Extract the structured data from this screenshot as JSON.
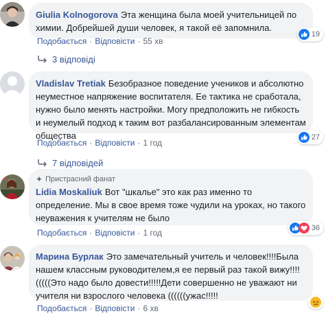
{
  "comments": [
    {
      "author": "Giulia Kolnogorova",
      "text": "Эта женщина была моей учительницей по химии. Добрейшей души человек, я такой её запомнила.",
      "reaction_icons": [
        "like-icon"
      ],
      "reaction_count": "19",
      "actions": {
        "like": "Подобається",
        "reply": "Відповісти",
        "time": "55 хв"
      },
      "replies_label": "3 відповіді"
    },
    {
      "author": "Vladislav Tretiak",
      "text": "Безобразное поведение учеников и абсолютно неуместное напряжение воспитателя. Ее тактика не сработала, нужно было менять настройки. Могу предположить не гибкость и неумелый подход к таким вот разбалансированным элементам общества",
      "reaction_icons": [
        "like-icon"
      ],
      "reaction_count": "27",
      "actions": {
        "like": "Подобається",
        "reply": "Відповісти",
        "time": "1 год"
      },
      "replies_label": "7 відповідей"
    },
    {
      "badge": "Пристрасний фанат",
      "author": "Lidia Moskaliuk",
      "text": "Вот \"шкалье\" это как раз именно то определение. Мы в свое время тоже чудили на уроках, но такого неуважения к учителям не было",
      "reaction_icons": [
        "like-icon",
        "love-icon"
      ],
      "reaction_count": "36",
      "actions": {
        "like": "Подобається",
        "reply": "Відповісти",
        "time": "1 год"
      }
    },
    {
      "author": "Марина Бурлак",
      "text": "Это замечательный учитель и человек!!!!Была нашем классным руководителем,я ее первый раз такой вижу!!!! (((((Это надо было довести!!!!!Дети совершенно не уважают ни учителя ни взрослого человека ((((((ужас!!!!!",
      "reaction_icons": [
        "sad-icon"
      ],
      "reaction_count": "",
      "actions": {
        "like": "Подобається",
        "reply": "Відповісти",
        "time": "6 хв"
      }
    }
  ],
  "colors": {
    "link": "#385898",
    "bubble": "#f2f3f5",
    "meta": "#606770",
    "like": "#1877f2",
    "love": "#f33e58",
    "sad": "#f7b928"
  }
}
